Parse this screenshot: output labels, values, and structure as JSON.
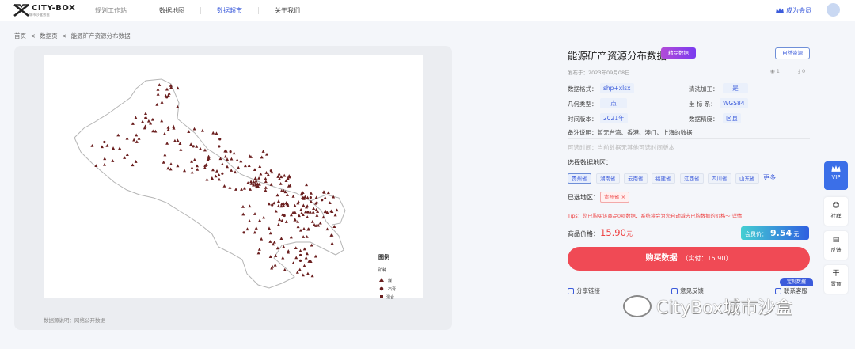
{
  "header": {
    "logo_text": "CITY-BOX",
    "logo_sub": "城市沙盒数据",
    "nav": [
      "规划工作站",
      "数据地图",
      "数据超市",
      "关于我们"
    ],
    "member_label": "成为会员"
  },
  "breadcrumb": [
    "首页",
    "<",
    "数据页",
    "<",
    "能源矿产资源分布数据"
  ],
  "map": {
    "legend_title": "图例",
    "legend_group": "矿种",
    "legend_items": [
      "煤",
      "石膏",
      "混合"
    ],
    "note": "数据源说明：网络公开数据",
    "prev": "‹",
    "next": "›"
  },
  "detail": {
    "title": "能源矿产资源分布数据",
    "premium_badge": "精品数据",
    "natural_button": "自然资源",
    "published": "发布于：2023年09月08日",
    "views": "1",
    "downloads": "0",
    "fields": [
      {
        "label": "数据格式：",
        "value": "shp+xlsx"
      },
      {
        "label": "清洗加工：",
        "value": "是"
      },
      {
        "label": "几何类型：",
        "value": "点"
      },
      {
        "label": "坐 标 系：",
        "value": "WGS84"
      },
      {
        "label": "时间版本：",
        "value": "2021年"
      },
      {
        "label": "数据精度：",
        "value": "区县"
      }
    ],
    "note": "备注说明：暂无台湾、香港、澳门、上海的数据",
    "optional_note": "可选时间：当前数据无其他可选时间版本",
    "region_title": "选择数据地区：",
    "regions": [
      "贵州省",
      "湖南省",
      "云南省",
      "福建省",
      "江西省",
      "四川省",
      "山东省"
    ],
    "more": "更多",
    "selected_label": "已选地区：",
    "selected_region": "贵州省 ×",
    "tips": "Tips：您已购买该商品0项数据，系统将会为您自动减去已购数据的价格～ 详情",
    "price_label": "商品价格：",
    "price": "15.90",
    "price_unit": "元",
    "member_price_label": "会员价：",
    "member_price": "9.54",
    "member_price_unit": "元",
    "buy_label": "购买数据",
    "buy_sub": "（实付：15.90）",
    "custom_tag": "定制数据",
    "actions": [
      "分享链接",
      "意见反馈",
      "联系客服"
    ]
  },
  "sidebar": {
    "vip": "VIP",
    "community": "社群",
    "feedback": "反馈",
    "top": "置顶",
    "top_icon": "干"
  },
  "watermark": "CityBox城市沙盒",
  "colors": {
    "accent": "#3b5bdb",
    "buy": "#f04a55",
    "marker": "#6b1f1f"
  }
}
